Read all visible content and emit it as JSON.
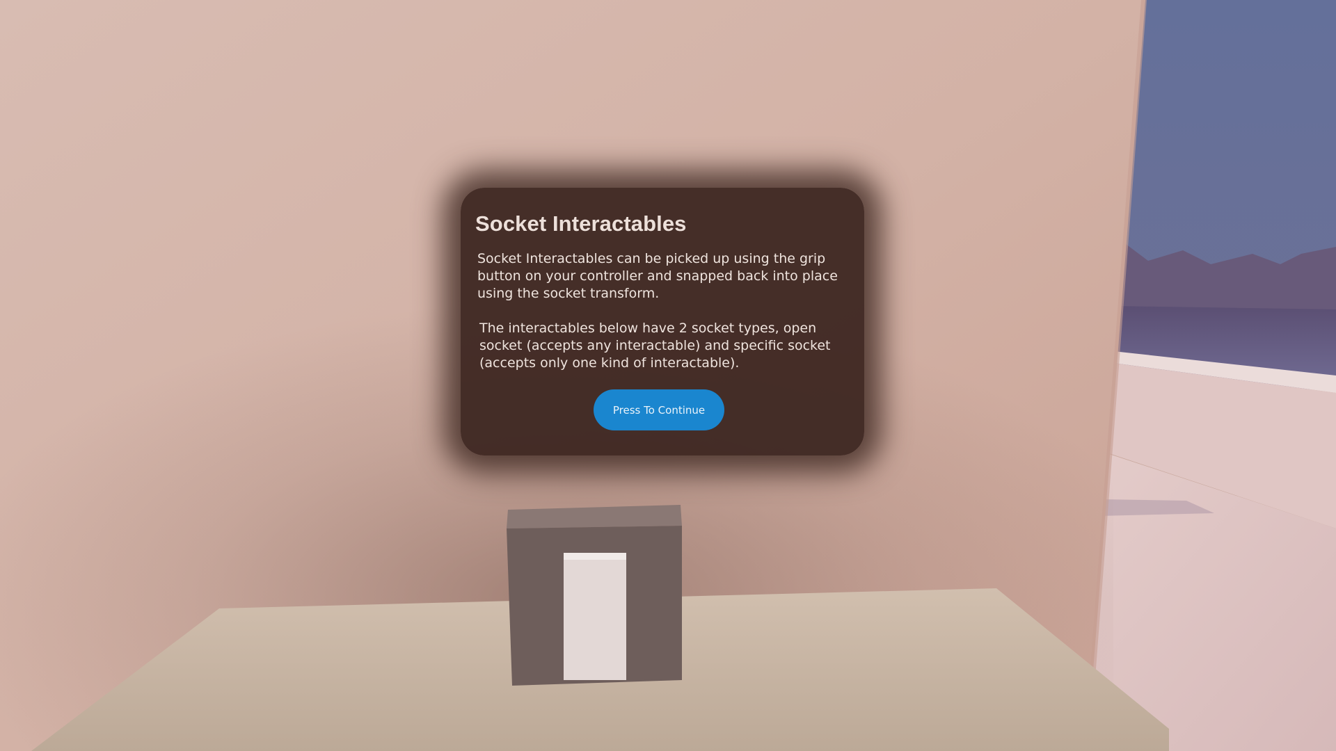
{
  "panel": {
    "title": "Socket Interactables",
    "paragraph_1": "Socket Interactables can be picked up using the grip button on your controller and snapped back into place using the socket transform.",
    "paragraph_2": "The interactables below have 2 socket types, open socket (accepts any interactable) and specific socket (accepts only one kind of interactable).",
    "button_label": "Press To Continue"
  },
  "colors": {
    "panel_background": "#3a241e",
    "button": "#1a86cf",
    "wall": "#d6b6ab",
    "sky": "#6a7196"
  }
}
